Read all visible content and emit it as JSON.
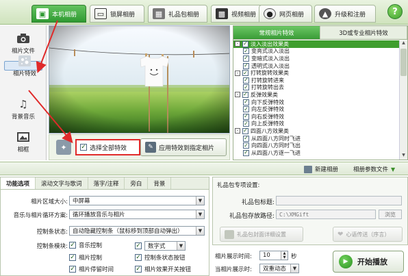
{
  "top_tabs": [
    {
      "label": "本机相册",
      "icon": "album-icon",
      "active": true
    },
    {
      "label": "锁屏相册",
      "icon": "monitor-icon",
      "active": false
    },
    {
      "label": "礼品包相册",
      "icon": "gift-icon",
      "active": false
    },
    {
      "label": "视频相册",
      "icon": "film-icon",
      "active": false
    },
    {
      "label": "网页相册",
      "icon": "globe-icon",
      "active": false
    },
    {
      "label": "升级和注册",
      "icon": "upgrade-icon",
      "active": false
    }
  ],
  "help_label": "?",
  "sidebar": {
    "items": [
      {
        "label": "相片文件",
        "icon": "camera-icon",
        "selected": false
      },
      {
        "label": "相片特效",
        "icon": "sparkle-icon",
        "selected": true
      },
      {
        "label": "背景音乐",
        "icon": "music-icon",
        "selected": false
      },
      {
        "label": "相框",
        "icon": "frame-icon",
        "selected": false
      }
    ]
  },
  "preview": {
    "image": "photo-of-white-tshirt-on-clothesline-in-grass-field"
  },
  "options": {
    "select_all_label": "选择全部特效",
    "select_all_checked": true,
    "apply_button_label": "应用特效到指定相片"
  },
  "effects": {
    "tabs": [
      {
        "label": "常规相片特效",
        "active": true
      },
      {
        "label": "3D或专业相片特效",
        "active": false
      }
    ],
    "rows": [
      {
        "type": "cat",
        "label": "淡入淡出效果类",
        "highlight": true
      },
      {
        "type": "item",
        "label": "变亮式淡入淡出"
      },
      {
        "type": "item",
        "label": "变暗式淡入淡出"
      },
      {
        "type": "item",
        "label": "透明式淡入淡出"
      },
      {
        "type": "cat",
        "label": "打转旋转效果类"
      },
      {
        "type": "item",
        "label": "打转旋转进来"
      },
      {
        "type": "item",
        "label": "打转旋转出去"
      },
      {
        "type": "cat",
        "label": "反弹效果类"
      },
      {
        "type": "item",
        "label": "向下反弹特效"
      },
      {
        "type": "item",
        "label": "向左反弹特效"
      },
      {
        "type": "item",
        "label": "向右反弹特效"
      },
      {
        "type": "item",
        "label": "向上反弹特效"
      },
      {
        "type": "cat",
        "label": "四面八方效果类"
      },
      {
        "type": "item",
        "label": "从四面八方同时飞进"
      },
      {
        "type": "item",
        "label": "向四面八方同时飞出"
      },
      {
        "type": "item",
        "label": "从四面八方逐一飞进"
      }
    ]
  },
  "bar": {
    "new_album_label": "新建相册",
    "params_label": "相册参数文件"
  },
  "settings": {
    "tabs": [
      {
        "label": "功能选项",
        "active": true
      },
      {
        "label": "滚动文字与歌词",
        "active": false
      },
      {
        "label": "落字/注释",
        "active": false
      },
      {
        "label": "旁白",
        "active": false
      },
      {
        "label": "背景",
        "active": false
      }
    ],
    "size_label": "相片区域大小:",
    "size_value": "中屏幕",
    "loop_label": "音乐与相片循环方案:",
    "loop_value": "循环播放音乐与相片",
    "control_label": "控制条状态:",
    "control_value": "自动隐藏控制条（鼠标移到顶部自动弹出）",
    "module_label": "控制条模块:",
    "checks": [
      {
        "label": "音乐控制",
        "checked": true
      },
      {
        "label": "数字式",
        "checked": true,
        "dropdown": true
      },
      {
        "label": "相片控制",
        "checked": true
      },
      {
        "label": "控制条状态按钮",
        "checked": true
      },
      {
        "label": "相片停留时间",
        "checked": true
      },
      {
        "label": "相片效果开关按钮",
        "checked": true
      }
    ]
  },
  "gift": {
    "title": "礼品包专项设置:",
    "title_label": "礼品包标题:",
    "title_value": "",
    "path_label": "礼品包存放路径:",
    "path_value": "C:\\XMGift",
    "browse_label": "浏览",
    "detail_btn": "礼品包封面详细设置",
    "heart_btn": "心语传送（序言）"
  },
  "timing": {
    "display_label": "相片展示时间:",
    "display_value": "10",
    "display_unit": "秒",
    "mode_label": "当相片展示时:",
    "mode_value": "双重动态"
  },
  "play_label": "开始播放"
}
